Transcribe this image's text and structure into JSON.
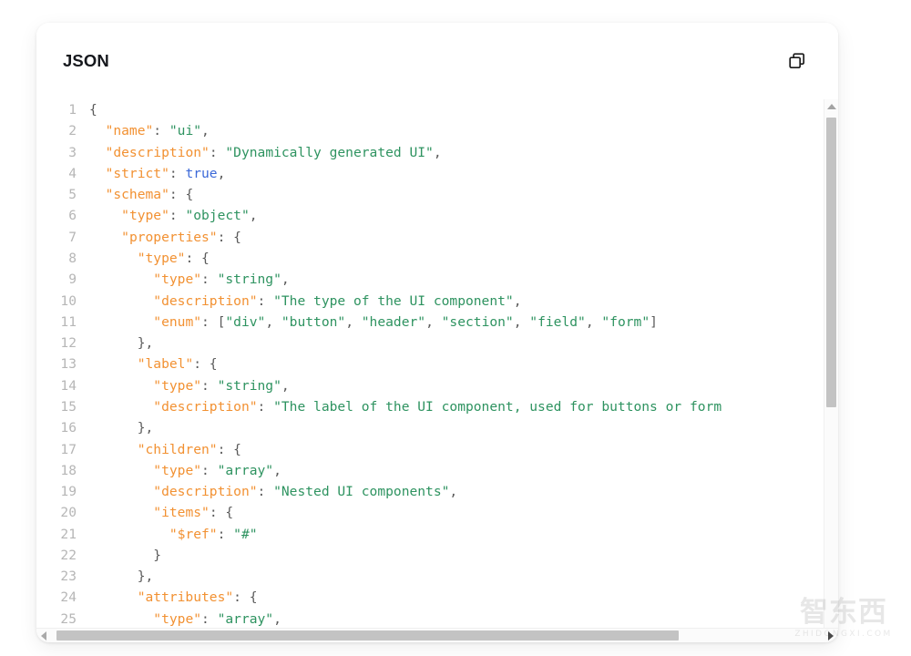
{
  "card": {
    "title": "JSON",
    "copy_button": {
      "label": "Copy",
      "icon": "copy-icon"
    }
  },
  "code": {
    "language": "json",
    "colors": {
      "key": "#f29132",
      "string": "#2e9360",
      "boolean": "#3b68d8",
      "punctuation": "#5a5a5a",
      "line_number": "#b6b6b6",
      "background": "#ffffff"
    },
    "lines": [
      {
        "n": "1",
        "indent": 0,
        "tokens": [
          {
            "t": "punct",
            "v": "{"
          }
        ]
      },
      {
        "n": "2",
        "indent": 1,
        "tokens": [
          {
            "t": "key",
            "v": "\"name\""
          },
          {
            "t": "punct",
            "v": ": "
          },
          {
            "t": "str",
            "v": "\"ui\""
          },
          {
            "t": "punct",
            "v": ","
          }
        ]
      },
      {
        "n": "3",
        "indent": 1,
        "tokens": [
          {
            "t": "key",
            "v": "\"description\""
          },
          {
            "t": "punct",
            "v": ": "
          },
          {
            "t": "str",
            "v": "\"Dynamically generated UI\""
          },
          {
            "t": "punct",
            "v": ","
          }
        ]
      },
      {
        "n": "4",
        "indent": 1,
        "tokens": [
          {
            "t": "key",
            "v": "\"strict\""
          },
          {
            "t": "punct",
            "v": ": "
          },
          {
            "t": "bool",
            "v": "true"
          },
          {
            "t": "punct",
            "v": ","
          }
        ]
      },
      {
        "n": "5",
        "indent": 1,
        "tokens": [
          {
            "t": "key",
            "v": "\"schema\""
          },
          {
            "t": "punct",
            "v": ": {"
          }
        ]
      },
      {
        "n": "6",
        "indent": 2,
        "tokens": [
          {
            "t": "key",
            "v": "\"type\""
          },
          {
            "t": "punct",
            "v": ": "
          },
          {
            "t": "str",
            "v": "\"object\""
          },
          {
            "t": "punct",
            "v": ","
          }
        ]
      },
      {
        "n": "7",
        "indent": 2,
        "tokens": [
          {
            "t": "key",
            "v": "\"properties\""
          },
          {
            "t": "punct",
            "v": ": {"
          }
        ]
      },
      {
        "n": "8",
        "indent": 3,
        "tokens": [
          {
            "t": "key",
            "v": "\"type\""
          },
          {
            "t": "punct",
            "v": ": {"
          }
        ]
      },
      {
        "n": "9",
        "indent": 4,
        "tokens": [
          {
            "t": "key",
            "v": "\"type\""
          },
          {
            "t": "punct",
            "v": ": "
          },
          {
            "t": "str",
            "v": "\"string\""
          },
          {
            "t": "punct",
            "v": ","
          }
        ]
      },
      {
        "n": "10",
        "indent": 4,
        "tokens": [
          {
            "t": "key",
            "v": "\"description\""
          },
          {
            "t": "punct",
            "v": ": "
          },
          {
            "t": "str",
            "v": "\"The type of the UI component\""
          },
          {
            "t": "punct",
            "v": ","
          }
        ]
      },
      {
        "n": "11",
        "indent": 4,
        "tokens": [
          {
            "t": "key",
            "v": "\"enum\""
          },
          {
            "t": "punct",
            "v": ": ["
          },
          {
            "t": "str",
            "v": "\"div\""
          },
          {
            "t": "punct",
            "v": ", "
          },
          {
            "t": "str",
            "v": "\"button\""
          },
          {
            "t": "punct",
            "v": ", "
          },
          {
            "t": "str",
            "v": "\"header\""
          },
          {
            "t": "punct",
            "v": ", "
          },
          {
            "t": "str",
            "v": "\"section\""
          },
          {
            "t": "punct",
            "v": ", "
          },
          {
            "t": "str",
            "v": "\"field\""
          },
          {
            "t": "punct",
            "v": ", "
          },
          {
            "t": "str",
            "v": "\"form\""
          },
          {
            "t": "punct",
            "v": "]"
          }
        ]
      },
      {
        "n": "12",
        "indent": 3,
        "tokens": [
          {
            "t": "punct",
            "v": "},"
          }
        ]
      },
      {
        "n": "13",
        "indent": 3,
        "tokens": [
          {
            "t": "key",
            "v": "\"label\""
          },
          {
            "t": "punct",
            "v": ": {"
          }
        ]
      },
      {
        "n": "14",
        "indent": 4,
        "tokens": [
          {
            "t": "key",
            "v": "\"type\""
          },
          {
            "t": "punct",
            "v": ": "
          },
          {
            "t": "str",
            "v": "\"string\""
          },
          {
            "t": "punct",
            "v": ","
          }
        ]
      },
      {
        "n": "15",
        "indent": 4,
        "tokens": [
          {
            "t": "key",
            "v": "\"description\""
          },
          {
            "t": "punct",
            "v": ": "
          },
          {
            "t": "str",
            "v": "\"The label of the UI component, used for buttons or form"
          }
        ]
      },
      {
        "n": "16",
        "indent": 3,
        "tokens": [
          {
            "t": "punct",
            "v": "},"
          }
        ]
      },
      {
        "n": "17",
        "indent": 3,
        "tokens": [
          {
            "t": "key",
            "v": "\"children\""
          },
          {
            "t": "punct",
            "v": ": {"
          }
        ]
      },
      {
        "n": "18",
        "indent": 4,
        "tokens": [
          {
            "t": "key",
            "v": "\"type\""
          },
          {
            "t": "punct",
            "v": ": "
          },
          {
            "t": "str",
            "v": "\"array\""
          },
          {
            "t": "punct",
            "v": ","
          }
        ]
      },
      {
        "n": "19",
        "indent": 4,
        "tokens": [
          {
            "t": "key",
            "v": "\"description\""
          },
          {
            "t": "punct",
            "v": ": "
          },
          {
            "t": "str",
            "v": "\"Nested UI components\""
          },
          {
            "t": "punct",
            "v": ","
          }
        ]
      },
      {
        "n": "20",
        "indent": 4,
        "tokens": [
          {
            "t": "key",
            "v": "\"items\""
          },
          {
            "t": "punct",
            "v": ": {"
          }
        ]
      },
      {
        "n": "21",
        "indent": 5,
        "tokens": [
          {
            "t": "key",
            "v": "\"$ref\""
          },
          {
            "t": "punct",
            "v": ": "
          },
          {
            "t": "str",
            "v": "\"#\""
          }
        ]
      },
      {
        "n": "22",
        "indent": 4,
        "tokens": [
          {
            "t": "punct",
            "v": "}"
          }
        ]
      },
      {
        "n": "23",
        "indent": 3,
        "tokens": [
          {
            "t": "punct",
            "v": "},"
          }
        ]
      },
      {
        "n": "24",
        "indent": 3,
        "tokens": [
          {
            "t": "key",
            "v": "\"attributes\""
          },
          {
            "t": "punct",
            "v": ": {"
          }
        ]
      },
      {
        "n": "25",
        "indent": 4,
        "tokens": [
          {
            "t": "key",
            "v": "\"type\""
          },
          {
            "t": "punct",
            "v": ": "
          },
          {
            "t": "str",
            "v": "\"array\""
          },
          {
            "t": "punct",
            "v": ","
          }
        ]
      }
    ]
  },
  "scrollbars": {
    "vertical": {
      "up_arrow": "▲",
      "down_arrow": "▼",
      "thumb_color": "#c3c3c3"
    },
    "horizontal": {
      "left_arrow": "◀",
      "right_arrow": "▶",
      "thumb_color": "#c3c3c3"
    }
  },
  "watermark": {
    "text": "智东西",
    "subtitle": "ZHIDONGXI.COM"
  }
}
